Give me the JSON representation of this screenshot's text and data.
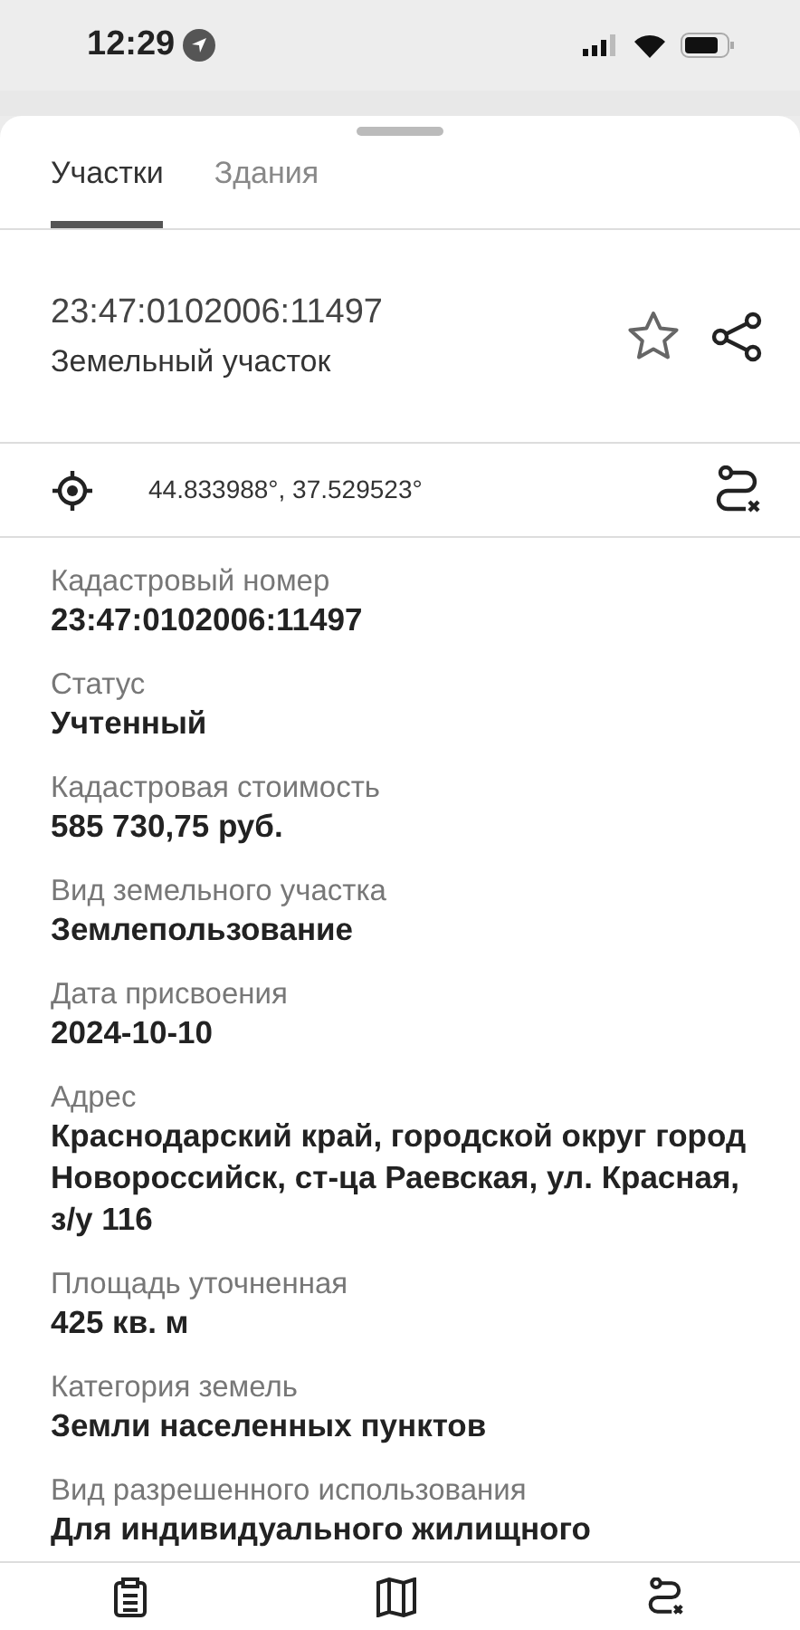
{
  "status_bar": {
    "time": "12:29"
  },
  "tabs": [
    {
      "label": "Участки",
      "selected": true
    },
    {
      "label": "Здания",
      "selected": false
    }
  ],
  "header": {
    "number": "23:47:0102006:11497",
    "type": "Земельный участок",
    "favorite": false
  },
  "coordinates": "44.833988°, 37.529523°",
  "fields": [
    {
      "label": "Кадастровый номер",
      "value": "23:47:0102006:11497"
    },
    {
      "label": "Статус",
      "value": "Учтенный"
    },
    {
      "label": "Кадастровая стоимость",
      "value": "585 730,75 руб."
    },
    {
      "label": "Вид земельного участка",
      "value": "Землепользование"
    },
    {
      "label": "Дата присвоения",
      "value": "2024-10-10"
    },
    {
      "label": "Адрес",
      "value": "Краснодарский край, городской округ город Новороссийск, ст-ца Раевская, ул. Красная, з/у 116"
    },
    {
      "label": "Площадь уточненная",
      "value": "425 кв. м"
    },
    {
      "label": "Категория земель",
      "value": "Земли населенных пунктов"
    },
    {
      "label": "Вид разрешенного использования",
      "value": "Для индивидуального жилищного"
    }
  ]
}
